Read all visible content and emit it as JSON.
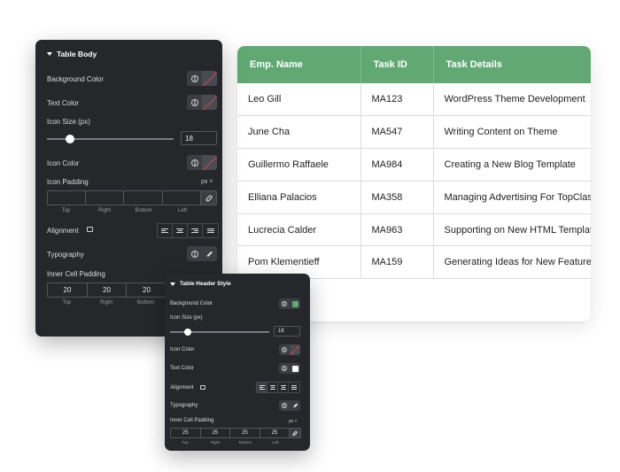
{
  "table": {
    "headers": [
      "Emp. Name",
      "Task ID",
      "Task Details"
    ],
    "rows": [
      [
        "Leo Gill",
        "MA123",
        "WordPress Theme Development"
      ],
      [
        "June Cha",
        "MA547",
        "Writing Content on Theme"
      ],
      [
        "Guillermo Raffaele",
        "MA984",
        "Creating a New Blog Template"
      ],
      [
        "Elliana Palacios",
        "MA358",
        "Managing Advertising For TopClass"
      ],
      [
        "Lucrecia Calder",
        "MA963",
        "Supporting on New HTML Template"
      ],
      [
        "Pom Klementieff",
        "MA159",
        "Generating Ideas for New Features"
      ]
    ],
    "header_color": "#61a874"
  },
  "table_body": {
    "title": "Table Body",
    "background_color_label": "Background Color",
    "text_color_label": "Text Color",
    "icon_size_label": "Icon Size (px)",
    "icon_size_value": "18",
    "icon_size_fraction": 0.18,
    "icon_color_label": "Icon Color",
    "icon_padding_label": "Icon Padding",
    "icon_padding_unit": "px",
    "side_labels": [
      "Top",
      "Right",
      "Bottom",
      "Left"
    ],
    "alignment_label": "Alignment",
    "typography_label": "Typography",
    "inner_cell_padding_label": "Inner Cell Padding",
    "inner_cell_padding_values": [
      "20",
      "20",
      "20"
    ]
  },
  "header_style": {
    "title": "Table Header Style",
    "background_color_label": "Background Color",
    "background_color_value": "#61a874",
    "icon_size_label": "Icon Size (px)",
    "icon_size_value": "18",
    "icon_size_fraction": 0.18,
    "icon_color_label": "Icon Color",
    "text_color_label": "Text Color",
    "text_color_value": "#ffffff",
    "alignment_label": "Alignment",
    "typography_label": "Typography",
    "inner_cell_padding_label": "Inner Cell Padding",
    "inner_cell_padding_unit": "px",
    "inner_cell_padding_values": [
      "25",
      "25",
      "25",
      "25"
    ],
    "side_labels": [
      "Top",
      "Right",
      "Bottom",
      "Left"
    ]
  }
}
